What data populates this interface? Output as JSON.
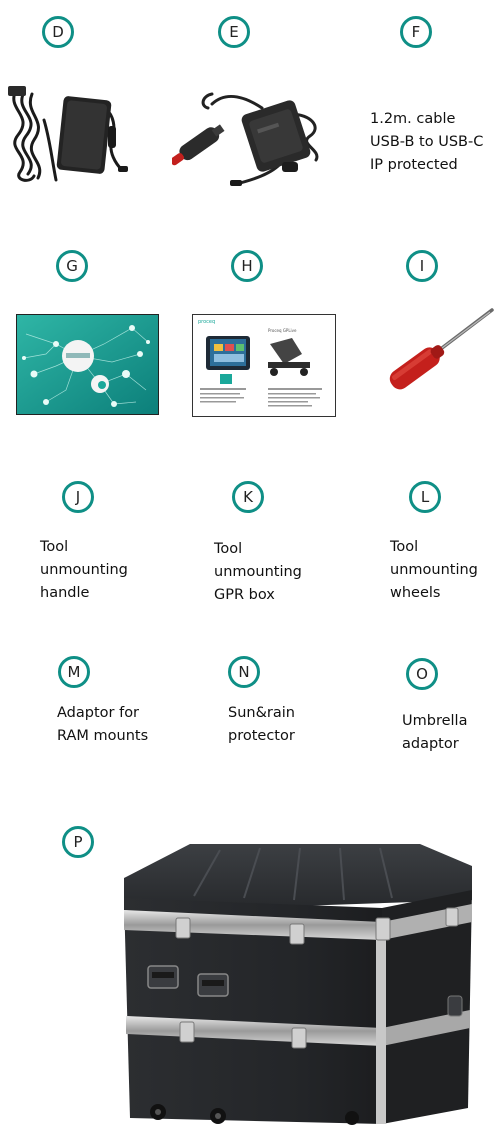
{
  "colors": {
    "badge_border": "#0f8f86",
    "accent_teal": "#1aa89a",
    "case_body": "#2b2d30",
    "screwdriver_red": "#c4201c"
  },
  "items": {
    "D": {
      "letter": "D",
      "image": "ac-power-adapter"
    },
    "E": {
      "letter": "E",
      "image": "car-power-adapter"
    },
    "F": {
      "letter": "F",
      "lines": [
        "1.2m. cable",
        "USB-B to USB-C",
        "IP protected"
      ]
    },
    "G": {
      "letter": "G",
      "image": "network-graphic-card"
    },
    "H": {
      "letter": "H",
      "image": "quick-start-guide",
      "brand": "proceq",
      "guide_title": "Proceq GPLive"
    },
    "I": {
      "letter": "I",
      "image": "screwdriver"
    },
    "J": {
      "letter": "J",
      "lines": [
        "Tool",
        "unmounting",
        "handle"
      ]
    },
    "K": {
      "letter": "K",
      "lines": [
        "Tool",
        "unmounting",
        "GPR box"
      ]
    },
    "L": {
      "letter": "L",
      "lines": [
        "Tool",
        "unmounting",
        "wheels"
      ]
    },
    "M": {
      "letter": "M",
      "lines": [
        "Adaptor for",
        "RAM mounts"
      ]
    },
    "N": {
      "letter": "N",
      "lines": [
        "Sun&rain",
        "protector"
      ]
    },
    "O": {
      "letter": "O",
      "lines": [
        "Umbrella",
        "adaptor"
      ]
    },
    "P": {
      "letter": "P",
      "image": "transport-case"
    }
  }
}
